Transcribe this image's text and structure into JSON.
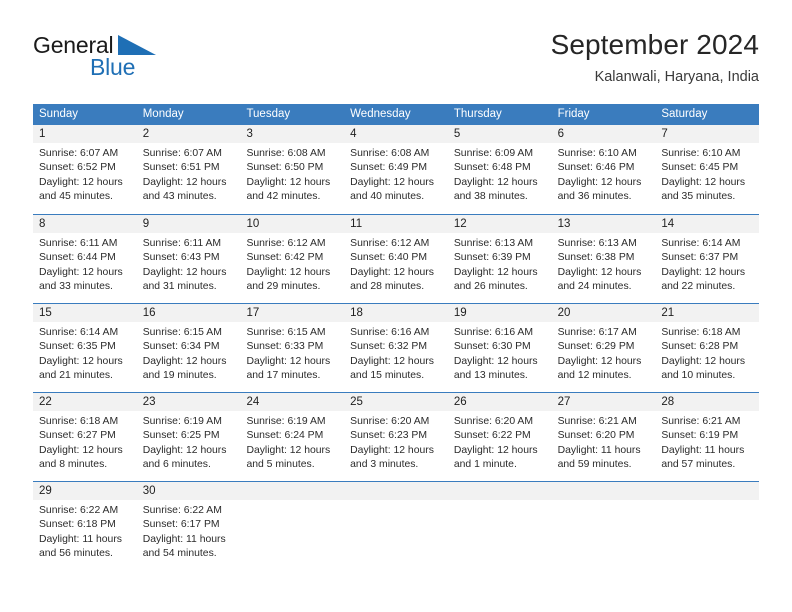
{
  "brand": {
    "name_top": "General",
    "name_bottom": "Blue",
    "triangle_color": "#1f6fb5"
  },
  "header": {
    "title": "September 2024",
    "subtitle": "Kalanwali, Haryana, India"
  },
  "theme": {
    "header_blue": "#3a7cbe",
    "day_band_gray": "#f2f2f2",
    "text_color": "#2b2b2b"
  },
  "weekdays": [
    "Sunday",
    "Monday",
    "Tuesday",
    "Wednesday",
    "Thursday",
    "Friday",
    "Saturday"
  ],
  "weeks": [
    [
      {
        "day": "1",
        "sunrise": "Sunrise: 6:07 AM",
        "sunset": "Sunset: 6:52 PM",
        "daylight": "Daylight: 12 hours and 45 minutes."
      },
      {
        "day": "2",
        "sunrise": "Sunrise: 6:07 AM",
        "sunset": "Sunset: 6:51 PM",
        "daylight": "Daylight: 12 hours and 43 minutes."
      },
      {
        "day": "3",
        "sunrise": "Sunrise: 6:08 AM",
        "sunset": "Sunset: 6:50 PM",
        "daylight": "Daylight: 12 hours and 42 minutes."
      },
      {
        "day": "4",
        "sunrise": "Sunrise: 6:08 AM",
        "sunset": "Sunset: 6:49 PM",
        "daylight": "Daylight: 12 hours and 40 minutes."
      },
      {
        "day": "5",
        "sunrise": "Sunrise: 6:09 AM",
        "sunset": "Sunset: 6:48 PM",
        "daylight": "Daylight: 12 hours and 38 minutes."
      },
      {
        "day": "6",
        "sunrise": "Sunrise: 6:10 AM",
        "sunset": "Sunset: 6:46 PM",
        "daylight": "Daylight: 12 hours and 36 minutes."
      },
      {
        "day": "7",
        "sunrise": "Sunrise: 6:10 AM",
        "sunset": "Sunset: 6:45 PM",
        "daylight": "Daylight: 12 hours and 35 minutes."
      }
    ],
    [
      {
        "day": "8",
        "sunrise": "Sunrise: 6:11 AM",
        "sunset": "Sunset: 6:44 PM",
        "daylight": "Daylight: 12 hours and 33 minutes."
      },
      {
        "day": "9",
        "sunrise": "Sunrise: 6:11 AM",
        "sunset": "Sunset: 6:43 PM",
        "daylight": "Daylight: 12 hours and 31 minutes."
      },
      {
        "day": "10",
        "sunrise": "Sunrise: 6:12 AM",
        "sunset": "Sunset: 6:42 PM",
        "daylight": "Daylight: 12 hours and 29 minutes."
      },
      {
        "day": "11",
        "sunrise": "Sunrise: 6:12 AM",
        "sunset": "Sunset: 6:40 PM",
        "daylight": "Daylight: 12 hours and 28 minutes."
      },
      {
        "day": "12",
        "sunrise": "Sunrise: 6:13 AM",
        "sunset": "Sunset: 6:39 PM",
        "daylight": "Daylight: 12 hours and 26 minutes."
      },
      {
        "day": "13",
        "sunrise": "Sunrise: 6:13 AM",
        "sunset": "Sunset: 6:38 PM",
        "daylight": "Daylight: 12 hours and 24 minutes."
      },
      {
        "day": "14",
        "sunrise": "Sunrise: 6:14 AM",
        "sunset": "Sunset: 6:37 PM",
        "daylight": "Daylight: 12 hours and 22 minutes."
      }
    ],
    [
      {
        "day": "15",
        "sunrise": "Sunrise: 6:14 AM",
        "sunset": "Sunset: 6:35 PM",
        "daylight": "Daylight: 12 hours and 21 minutes."
      },
      {
        "day": "16",
        "sunrise": "Sunrise: 6:15 AM",
        "sunset": "Sunset: 6:34 PM",
        "daylight": "Daylight: 12 hours and 19 minutes."
      },
      {
        "day": "17",
        "sunrise": "Sunrise: 6:15 AM",
        "sunset": "Sunset: 6:33 PM",
        "daylight": "Daylight: 12 hours and 17 minutes."
      },
      {
        "day": "18",
        "sunrise": "Sunrise: 6:16 AM",
        "sunset": "Sunset: 6:32 PM",
        "daylight": "Daylight: 12 hours and 15 minutes."
      },
      {
        "day": "19",
        "sunrise": "Sunrise: 6:16 AM",
        "sunset": "Sunset: 6:30 PM",
        "daylight": "Daylight: 12 hours and 13 minutes."
      },
      {
        "day": "20",
        "sunrise": "Sunrise: 6:17 AM",
        "sunset": "Sunset: 6:29 PM",
        "daylight": "Daylight: 12 hours and 12 minutes."
      },
      {
        "day": "21",
        "sunrise": "Sunrise: 6:18 AM",
        "sunset": "Sunset: 6:28 PM",
        "daylight": "Daylight: 12 hours and 10 minutes."
      }
    ],
    [
      {
        "day": "22",
        "sunrise": "Sunrise: 6:18 AM",
        "sunset": "Sunset: 6:27 PM",
        "daylight": "Daylight: 12 hours and 8 minutes."
      },
      {
        "day": "23",
        "sunrise": "Sunrise: 6:19 AM",
        "sunset": "Sunset: 6:25 PM",
        "daylight": "Daylight: 12 hours and 6 minutes."
      },
      {
        "day": "24",
        "sunrise": "Sunrise: 6:19 AM",
        "sunset": "Sunset: 6:24 PM",
        "daylight": "Daylight: 12 hours and 5 minutes."
      },
      {
        "day": "25",
        "sunrise": "Sunrise: 6:20 AM",
        "sunset": "Sunset: 6:23 PM",
        "daylight": "Daylight: 12 hours and 3 minutes."
      },
      {
        "day": "26",
        "sunrise": "Sunrise: 6:20 AM",
        "sunset": "Sunset: 6:22 PM",
        "daylight": "Daylight: 12 hours and 1 minute."
      },
      {
        "day": "27",
        "sunrise": "Sunrise: 6:21 AM",
        "sunset": "Sunset: 6:20 PM",
        "daylight": "Daylight: 11 hours and 59 minutes."
      },
      {
        "day": "28",
        "sunrise": "Sunrise: 6:21 AM",
        "sunset": "Sunset: 6:19 PM",
        "daylight": "Daylight: 11 hours and 57 minutes."
      }
    ],
    [
      {
        "day": "29",
        "sunrise": "Sunrise: 6:22 AM",
        "sunset": "Sunset: 6:18 PM",
        "daylight": "Daylight: 11 hours and 56 minutes."
      },
      {
        "day": "30",
        "sunrise": "Sunrise: 6:22 AM",
        "sunset": "Sunset: 6:17 PM",
        "daylight": "Daylight: 11 hours and 54 minutes."
      },
      {
        "day": "",
        "sunrise": "",
        "sunset": "",
        "daylight": ""
      },
      {
        "day": "",
        "sunrise": "",
        "sunset": "",
        "daylight": ""
      },
      {
        "day": "",
        "sunrise": "",
        "sunset": "",
        "daylight": ""
      },
      {
        "day": "",
        "sunrise": "",
        "sunset": "",
        "daylight": ""
      },
      {
        "day": "",
        "sunrise": "",
        "sunset": "",
        "daylight": ""
      }
    ]
  ]
}
